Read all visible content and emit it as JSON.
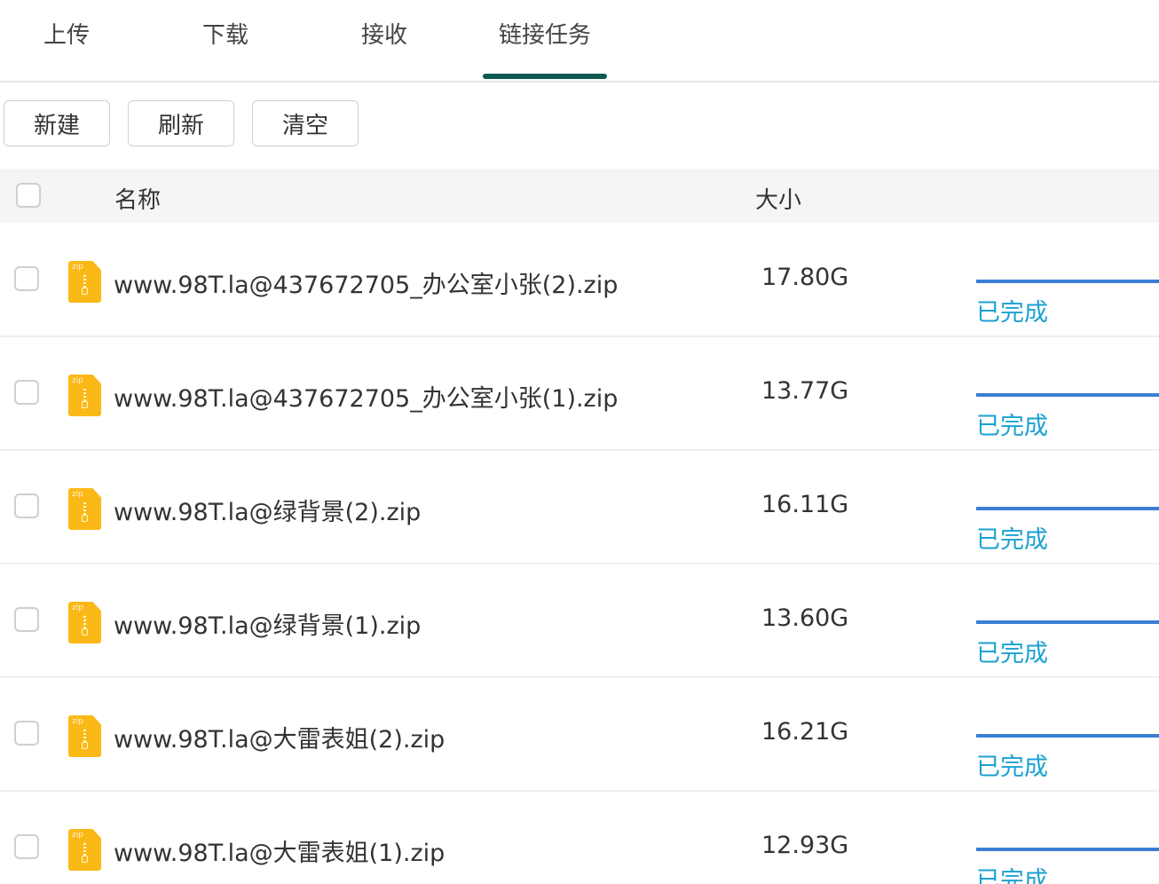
{
  "tabs": [
    {
      "label": "上传"
    },
    {
      "label": "下载"
    },
    {
      "label": "接收"
    },
    {
      "label": "链接任务",
      "active": true
    }
  ],
  "toolbar": {
    "new_label": "新建",
    "refresh_label": "刷新",
    "clear_label": "清空"
  },
  "table": {
    "columns": {
      "name": "名称",
      "size": "大小"
    },
    "rows": [
      {
        "name": "www.98T.la@437672705_办公室小张(2).zip",
        "size": "17.80G",
        "status": "已完成",
        "progress": 1.0,
        "type_label": "zip"
      },
      {
        "name": "www.98T.la@437672705_办公室小张(1).zip",
        "size": "13.77G",
        "status": "已完成",
        "progress": 1.0,
        "type_label": "zip"
      },
      {
        "name": "www.98T.la@绿背景(2).zip",
        "size": "16.11G",
        "status": "已完成",
        "progress": 1.0,
        "type_label": "zip"
      },
      {
        "name": "www.98T.la@绿背景(1).zip",
        "size": "13.60G",
        "status": "已完成",
        "progress": 1.0,
        "type_label": "zip"
      },
      {
        "name": "www.98T.la@大雷表姐(2).zip",
        "size": "16.21G",
        "status": "已完成",
        "progress": 1.0,
        "type_label": "zip"
      },
      {
        "name": "www.98T.la@大雷表姐(1).zip",
        "size": "12.93G",
        "status": "已完成",
        "progress": 1.0,
        "type_label": "zip"
      }
    ]
  },
  "colors": {
    "tab_indicator": "#0e5a52",
    "progress": "#3b7fd4",
    "status": "#1aa1d2",
    "file_icon": "#fbb917"
  }
}
